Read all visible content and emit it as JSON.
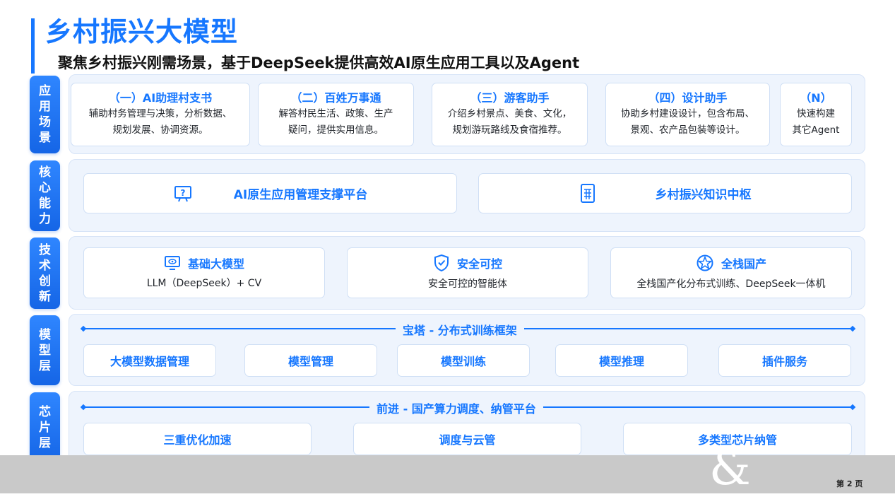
{
  "header": {
    "title": "乡村振兴大模型",
    "subtitle": "聚焦乡村振兴刚需场景，基于DeepSeek提供高效AI原生应用工具以及Agent"
  },
  "rows": {
    "scenes": {
      "label": "应用场景",
      "cards": [
        {
          "title": "（一）AI助理村支书",
          "line1": "辅助村务管理与决策，分析数据、",
          "line2": "规划发展、协调资源。"
        },
        {
          "title": "（二）百姓万事通",
          "line1": "解答村民生活、政策、生产",
          "line2": "疑问，提供实用信息。"
        },
        {
          "title": "（三）游客助手",
          "line1": "介绍乡村景点、美食、文化，",
          "line2": "规划游玩路线及食宿推荐。"
        },
        {
          "title": "（四）设计助手",
          "line1": "协助乡村建设设计，包含布局、",
          "line2": "景观、农产品包装等设计。"
        },
        {
          "title": "（N）",
          "line1": "快速构建",
          "line2": "其它Agent"
        }
      ]
    },
    "core": {
      "label": "核心能力",
      "items": [
        {
          "title": "AI原生应用管理支撑平台",
          "icon": "help-screen-icon"
        },
        {
          "title": "乡村振兴知识中枢",
          "icon": "document-grid-icon"
        }
      ]
    },
    "tech": {
      "label": "技术创新",
      "items": [
        {
          "title": "基础大模型",
          "desc": "LLM（DeepSeek）+ CV",
          "icon": "monitor-eye-icon"
        },
        {
          "title": "安全可控",
          "desc": "安全可控的智能体",
          "icon": "shield-check-icon"
        },
        {
          "title": "全栈国产",
          "desc": "全栈国产化分布式训练、DeepSeek一体机",
          "icon": "star-circle-icon"
        }
      ]
    },
    "model": {
      "label": "模型层",
      "framework": "宝塔 - 分布式训练框架",
      "items": [
        "大模型数据管理",
        "模型管理",
        "模型训练",
        "模型推理",
        "插件服务"
      ]
    },
    "chip": {
      "label": "芯片层",
      "framework": "前进 - 国产算力调度、纳管平台",
      "items": [
        "三重优化加速",
        "调度与云管",
        "多类型芯片纳管"
      ]
    }
  },
  "footer": {
    "page": "第 2 页",
    "watermark": "&"
  },
  "colors": {
    "accent": "#1677ff",
    "panel": "#eef4fd",
    "band": "#c9c9c9"
  }
}
